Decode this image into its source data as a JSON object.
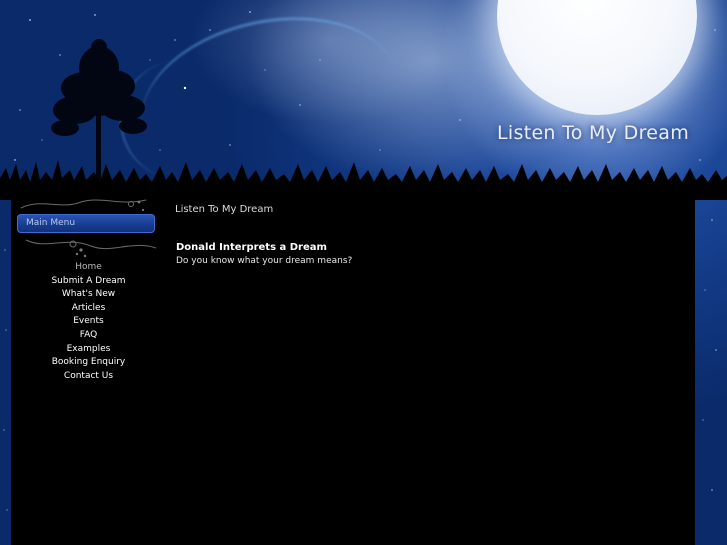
{
  "header": {
    "site_title": "Listen To My Dream"
  },
  "sidebar": {
    "menu_title": "Main Menu",
    "items": [
      {
        "label": "Home"
      },
      {
        "label": "Submit A Dream"
      },
      {
        "label": "What's New"
      },
      {
        "label": "Articles"
      },
      {
        "label": "Events"
      },
      {
        "label": "FAQ"
      },
      {
        "label": "Examples"
      },
      {
        "label": "Booking Enquiry"
      },
      {
        "label": "Contact Us"
      }
    ],
    "active_item": "Home"
  },
  "main": {
    "page_heading": "Listen To My Dream",
    "article": {
      "title": "Donald Interprets a Dream",
      "teaser": "Do you know what your dream means?"
    }
  },
  "colors": {
    "sky_blue": "#0d2f78",
    "panel_black": "#000000",
    "menu_header_blue": "#1e48a4",
    "text_white": "#ffffff",
    "active_gray": "#b8b8b8"
  }
}
